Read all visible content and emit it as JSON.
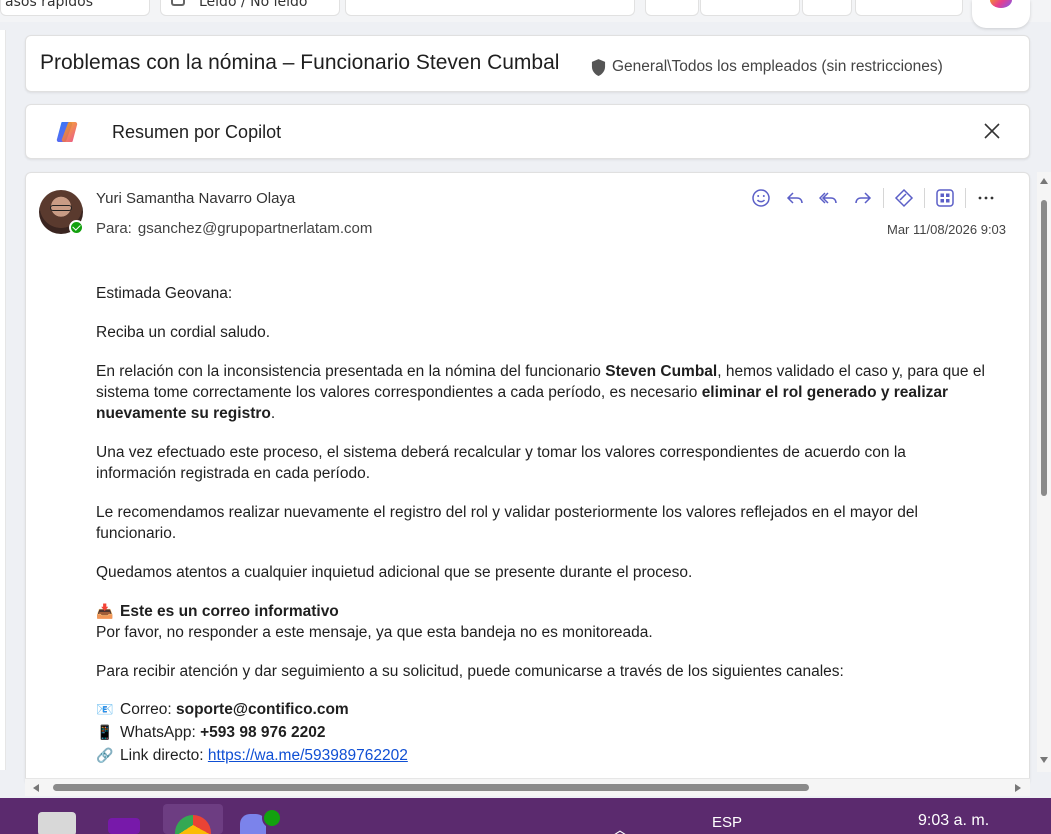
{
  "ribbon": {
    "quick_steps_label": "asos rápidos",
    "read_unread_label": "Leído / No leído"
  },
  "subject": {
    "title": "Problemas con la nómina – Funcionario Steven Cumbal",
    "sensitivity": "General\\Todos los empleados (sin restricciones)"
  },
  "copilot": {
    "title": "Resumen por Copilot"
  },
  "message": {
    "sender": "Yuri Samantha Navarro Olaya",
    "to_label": "Para:",
    "to": "gsanchez@grupopartnerlatam.com",
    "date": "Mar 11/08/2026 9:03",
    "greeting": "Estimada Geovana:",
    "salutation": "Reciba un cordial saludo.",
    "p1_a": "En relación con la inconsistencia presentada en la nómina del funcionario ",
    "p1_b": "Steven Cumbal",
    "p1_c": ", hemos validado el caso y, para que el sistema tome correctamente los valores correspondientes a cada período, es necesario ",
    "p1_d": "eliminar el rol generado y realizar nuevamente su registro",
    "p1_e": ".",
    "p2": "Una vez efectuado este proceso, el sistema deberá recalcular y tomar los valores correspondientes de acuerdo con la información registrada en cada período.",
    "p3": "Le recomendamos realizar nuevamente el registro del rol y validar posteriormente los valores reflejados en el mayor del funcionario.",
    "p4": "Quedamos atentos a cualquier inquietud adicional que se presente durante el proceso.",
    "info_heading": "Este es un correo informativo",
    "info_text": "Por favor, no responder a este mensaje, ya que esta bandeja no es monitoreada.",
    "channels_intro": "Para recibir atención y dar seguimiento a su solicitud, puede comunicarse a través de los siguientes canales:",
    "email_label": "Correo: ",
    "email_value": "soporte@contifico.com",
    "whatsapp_label": "WhatsApp: ",
    "whatsapp_value": "+593 98 976 2202",
    "link_label": "Link directo: ",
    "link_value": "https://wa.me/593989762202"
  },
  "taskbar": {
    "language": "ESP",
    "time": "9:03 a. m."
  },
  "colors": {
    "accent": "#5b5fc7",
    "taskbar": "#5b2a6e",
    "link": "#0f4fd4",
    "presence": "#13a10e"
  }
}
